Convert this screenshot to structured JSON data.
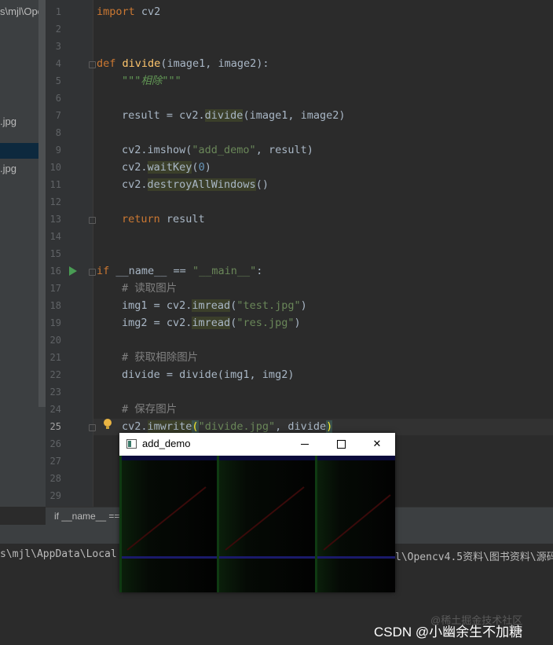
{
  "project_panel": {
    "items": [
      "s\\mjl\\Openc",
      ".jpg",
      ".jpg"
    ]
  },
  "editor": {
    "current_line": 25,
    "line_numbers": [
      "1",
      "2",
      "3",
      "4",
      "5",
      "6",
      "7",
      "8",
      "9",
      "10",
      "11",
      "12",
      "13",
      "14",
      "15",
      "16",
      "17",
      "18",
      "19",
      "20",
      "21",
      "22",
      "23",
      "24",
      "25",
      "26",
      "27",
      "28",
      "29"
    ],
    "code": {
      "l1_kw": "import",
      "l1_rest": " cv2",
      "l4_kw": "def",
      "l4_fn": "divide",
      "l4_rest": "(image1, image2):",
      "l5_doc": "\"\"\"相除\"\"\"",
      "l7_a": "result = cv2.",
      "l7_b": "divide",
      "l7_c": "(image1, image2)",
      "l9_a": "cv2.imshow(",
      "l9_str": "\"add_demo\"",
      "l9_c": ", result)",
      "l10_a": "cv2.",
      "l10_b": "waitKey",
      "l10_c": "(",
      "l10_num": "0",
      "l10_d": ")",
      "l11_a": "cv2.",
      "l11_b": "destroyAllWindows",
      "l11_c": "()",
      "l13_kw": "return",
      "l13_rest": " result",
      "l16_kw": "if",
      "l16_a": " __name__ == ",
      "l16_str": "\"__main__\"",
      "l16_b": ":",
      "l17_cmt": "# 读取图片",
      "l18_a": "img1 = cv2.",
      "l18_b": "imread",
      "l18_c": "(",
      "l18_str": "\"test.jpg\"",
      "l18_d": ")",
      "l19_a": "img2 = cv2.",
      "l19_b": "imread",
      "l19_c": "(",
      "l19_str": "\"res.jpg\"",
      "l19_d": ")",
      "l21_cmt": "# 获取相除图片",
      "l22_a": "divide = divide(img1, img2)",
      "l24_cmt": "# 保存图片",
      "l25_a": "cv2.",
      "l25_b": "imwrite",
      "l25_c": "(",
      "l25_str": "\"divide.jpg\"",
      "l25_d": ", divide",
      "l25_e": ")"
    }
  },
  "breadcrumb": "if __name__ ==",
  "console": {
    "left": "s\\mjl\\AppData\\Local",
    "right": "l\\Opencv4.5资料\\图书资料\\源码"
  },
  "popup_window": {
    "title": "add_demo",
    "minimize_label": "",
    "maximize_label": "",
    "close_label": "✕"
  },
  "watermark": {
    "line1": "@稀土掘金技术社区",
    "line2": "CSDN @小幽余生不加糖"
  }
}
